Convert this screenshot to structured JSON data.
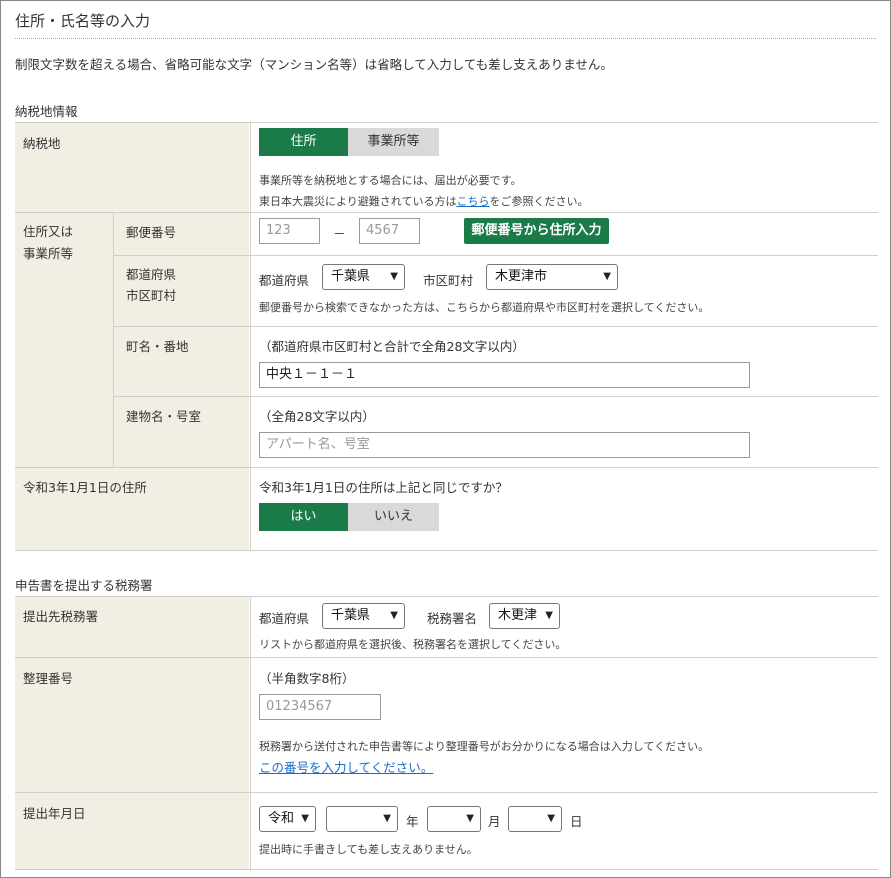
{
  "page": {
    "title": "住所・氏名等の入力",
    "notice": "制限文字数を超える場合、省略可能な文字（マンション名等）は省略して入力しても差し支えありません。"
  },
  "taxplace_section": {
    "heading": "納税地情報",
    "nouzeichi": {
      "label": "納税地",
      "options": [
        "住所",
        "事業所等"
      ],
      "note1": "事業所等を納税地とする場合には、届出が必要です。",
      "note2_prefix": "東日本大震災により避難されている方は",
      "note2_link": "こちら",
      "note2_suffix": "をご参照ください。"
    },
    "address": {
      "label_line1": "住所又は",
      "label_line2": "事業所等",
      "postal": {
        "label": "郵便番号",
        "first_placeholder": "123",
        "dash": "－",
        "second_placeholder": "4567",
        "lookup_button": "郵便番号から住所入力"
      },
      "pref_city": {
        "label_line1": "都道府県",
        "label_line2": "市区町村",
        "pref_label": "都道府県",
        "pref_value": "千葉県",
        "city_label": "市区町村",
        "city_value": "木更津市",
        "note": "郵便番号から検索できなかった方は、こちらから都道府県や市区町村を選択してください。"
      },
      "town": {
        "label": "町名・番地",
        "hint": "（都道府県市区町村と合計で全角28文字以内）",
        "value": "中央１－１－１"
      },
      "building": {
        "label": "建物名・号室",
        "hint": "（全角28文字以内）",
        "placeholder": "アパート名、号室"
      }
    },
    "prev_address": {
      "label": "令和3年1月1日の住所",
      "question": "令和3年1月1日の住所は上記と同じですか？",
      "options": [
        "はい",
        "いいえ"
      ]
    }
  },
  "office_section": {
    "heading": "申告書を提出する税務署",
    "office": {
      "label": "提出先税務署",
      "pref_label": "都道府県",
      "pref_value": "千葉県",
      "office_label": "税務署名",
      "office_value": "木更津",
      "note": "リストから都道府県を選択後、税務署名を選択してください。"
    },
    "ref_number": {
      "label": "整理番号",
      "hint": "（半角数字8桁）",
      "placeholder": "01234567",
      "note": "税務署から送付された申告書等により整理番号がお分かりになる場合は入力してください。",
      "link": "この番号を入力してください。"
    },
    "date": {
      "label": "提出年月日",
      "era_value": "令和",
      "year_value": "",
      "year_unit": "年",
      "month_value": "",
      "month_unit": "月",
      "day_value": "",
      "day_unit": "日",
      "note": "提出時に手書きしても差し支えありません。"
    }
  },
  "colors": {
    "accent": "#1a7a48",
    "label_bg": "#f1efe4",
    "link": "#1a6cc8",
    "toggle_off": "#d9d9d9"
  },
  "icons": {
    "select_arrow": "chevron-down-icon"
  }
}
